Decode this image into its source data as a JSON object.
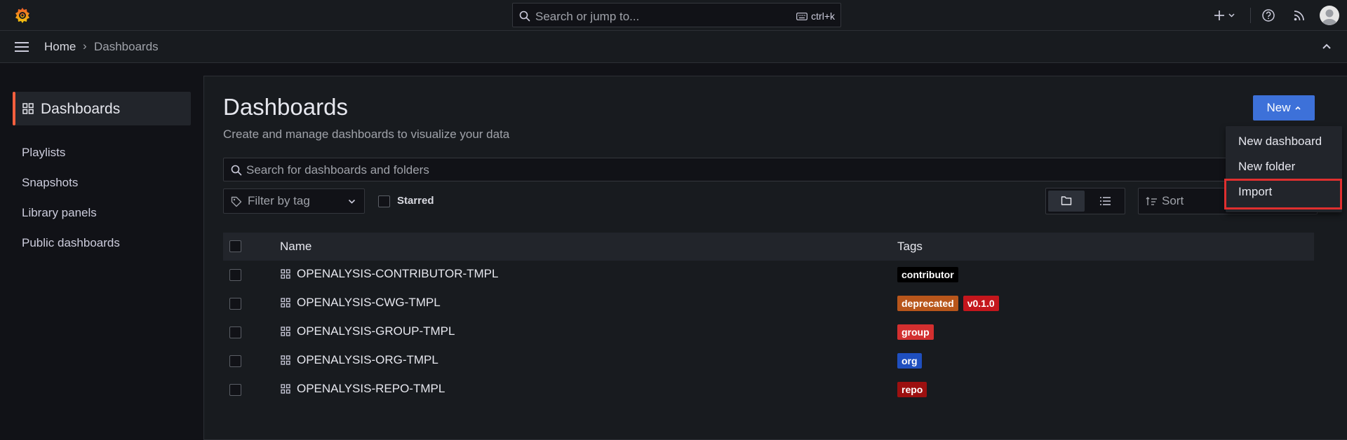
{
  "topbar": {
    "search_placeholder": "Search or jump to...",
    "search_shortcut": "ctrl+k"
  },
  "breadcrumb": {
    "home": "Home",
    "separator": "›",
    "current": "Dashboards"
  },
  "sidenav": {
    "active": "Dashboards",
    "items": [
      "Playlists",
      "Snapshots",
      "Library panels",
      "Public dashboards"
    ]
  },
  "page": {
    "title": "Dashboards",
    "subtitle": "Create and manage dashboards to visualize your data",
    "new_button": "New",
    "search_placeholder": "Search for dashboards and folders",
    "tag_filter_placeholder": "Filter by tag",
    "starred_label": "Starred",
    "sort_placeholder": "Sort"
  },
  "table": {
    "columns": {
      "name": "Name",
      "tags": "Tags"
    },
    "rows": [
      {
        "name": "OPENALYSIS-CONTRIBUTOR-TMPL",
        "tags": [
          {
            "label": "contributor",
            "color": "#000000"
          }
        ]
      },
      {
        "name": "OPENALYSIS-CWG-TMPL",
        "tags": [
          {
            "label": "deprecated",
            "color": "#b8561b"
          },
          {
            "label": "v0.1.0",
            "color": "#c4161c"
          }
        ]
      },
      {
        "name": "OPENALYSIS-GROUP-TMPL",
        "tags": [
          {
            "label": "group",
            "color": "#d32f2f"
          }
        ]
      },
      {
        "name": "OPENALYSIS-ORG-TMPL",
        "tags": [
          {
            "label": "org",
            "color": "#1f4fbf"
          }
        ]
      },
      {
        "name": "OPENALYSIS-REPO-TMPL",
        "tags": [
          {
            "label": "repo",
            "color": "#9c1010"
          }
        ]
      }
    ]
  },
  "new_menu": {
    "items": [
      "New dashboard",
      "New folder",
      "Import"
    ],
    "highlighted": "Import",
    "highlight_color": "#e02f2f"
  },
  "colors": {
    "accent": "#f55f3e",
    "primary": "#3d71d9"
  }
}
